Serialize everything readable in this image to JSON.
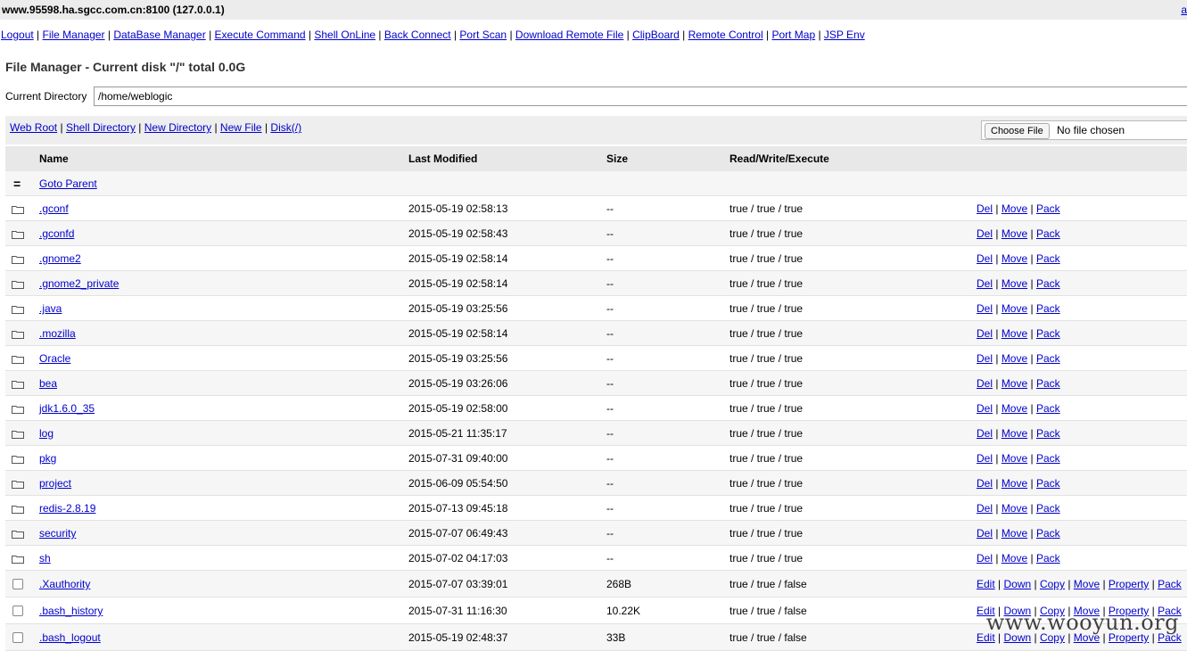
{
  "window": {
    "host": "www.95598.ha.sgcc.com.cn:8100 (127.0.0.1)",
    "corner_link": "a"
  },
  "nav": [
    "Logout",
    "File Manager",
    "DataBase Manager",
    "Execute Command",
    "Shell OnLine",
    "Back Connect",
    "Port Scan",
    "Download Remote File",
    "ClipBoard",
    "Remote Control",
    "Port Map",
    "JSP Env"
  ],
  "heading": "File Manager - Current disk \"/\" total 0.0G",
  "current_directory": {
    "label": "Current Directory",
    "value": "/home/weblogic"
  },
  "toolbar": {
    "links": [
      "Web Root",
      "Shell Directory",
      "New Directory",
      "New File",
      "Disk(/)"
    ],
    "upload": {
      "button": "Choose File",
      "status": "No file chosen"
    }
  },
  "table": {
    "headers": {
      "name": "Name",
      "modified": "Last Modified",
      "size": "Size",
      "rwx": "Read/Write/Execute"
    },
    "parent": {
      "icon": "=",
      "label": "Goto Parent"
    },
    "dir_actions": [
      "Del",
      "Move",
      "Pack"
    ],
    "file_actions": [
      "Edit",
      "Down",
      "Copy",
      "Move",
      "Property",
      "Pack"
    ],
    "dirs": [
      {
        "name": ".gconf",
        "modified": "2015-05-19 02:58:13",
        "size": "--",
        "rwx": "true / true / true"
      },
      {
        "name": ".gconfd",
        "modified": "2015-05-19 02:58:43",
        "size": "--",
        "rwx": "true / true / true"
      },
      {
        "name": ".gnome2",
        "modified": "2015-05-19 02:58:14",
        "size": "--",
        "rwx": "true / true / true"
      },
      {
        "name": ".gnome2_private",
        "modified": "2015-05-19 02:58:14",
        "size": "--",
        "rwx": "true / true / true"
      },
      {
        "name": ".java",
        "modified": "2015-05-19 03:25:56",
        "size": "--",
        "rwx": "true / true / true"
      },
      {
        "name": ".mozilla",
        "modified": "2015-05-19 02:58:14",
        "size": "--",
        "rwx": "true / true / true"
      },
      {
        "name": "Oracle",
        "modified": "2015-05-19 03:25:56",
        "size": "--",
        "rwx": "true / true / true"
      },
      {
        "name": "bea",
        "modified": "2015-05-19 03:26:06",
        "size": "--",
        "rwx": "true / true / true"
      },
      {
        "name": "jdk1.6.0_35",
        "modified": "2015-05-19 02:58:00",
        "size": "--",
        "rwx": "true / true / true"
      },
      {
        "name": "log",
        "modified": "2015-05-21 11:35:17",
        "size": "--",
        "rwx": "true / true / true"
      },
      {
        "name": "pkg",
        "modified": "2015-07-31 09:40:00",
        "size": "--",
        "rwx": "true / true / true"
      },
      {
        "name": "project",
        "modified": "2015-06-09 05:54:50",
        "size": "--",
        "rwx": "true / true / true"
      },
      {
        "name": "redis-2.8.19",
        "modified": "2015-07-13 09:45:18",
        "size": "--",
        "rwx": "true / true / true"
      },
      {
        "name": "security",
        "modified": "2015-07-07 06:49:43",
        "size": "--",
        "rwx": "true / true / true"
      },
      {
        "name": "sh",
        "modified": "2015-07-02 04:17:03",
        "size": "--",
        "rwx": "true / true / true"
      }
    ],
    "files": [
      {
        "name": ".Xauthority",
        "modified": "2015-07-07 03:39:01",
        "size": "268B",
        "rwx": "true / true / false"
      },
      {
        "name": ".bash_history",
        "modified": "2015-07-31 11:16:30",
        "size": "10.22K",
        "rwx": "true / true / false"
      },
      {
        "name": ".bash_logout",
        "modified": "2015-05-19 02:48:37",
        "size": "33B",
        "rwx": "true / true / false"
      }
    ]
  },
  "watermark": "www.wooyun.org",
  "colors": {
    "link": "#0000cc",
    "toolbar_bg": "#eeeeee",
    "header_bg": "#e8e8e8"
  }
}
